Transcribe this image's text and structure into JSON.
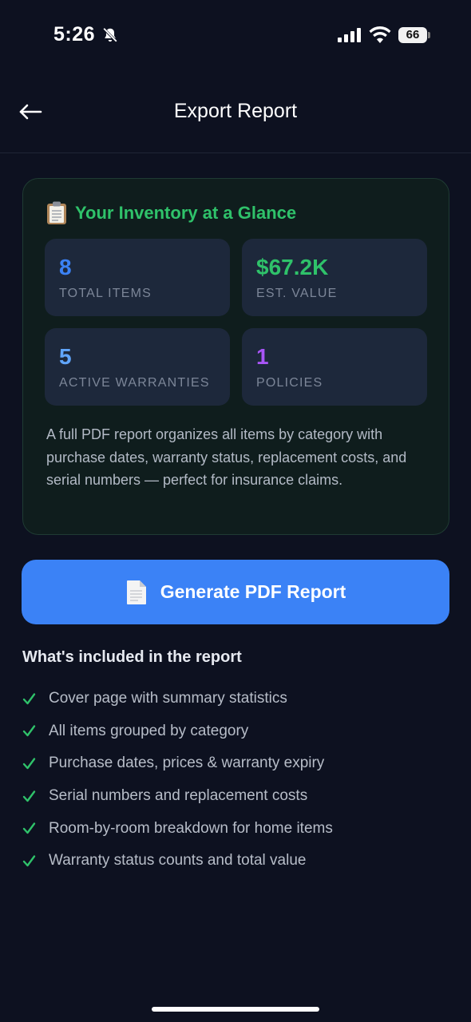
{
  "status": {
    "time": "5:26",
    "battery": "66",
    "icons": [
      "bell-slash-icon",
      "signal-icon",
      "wifi-icon",
      "battery-icon"
    ]
  },
  "header": {
    "title": "Export Report",
    "back_icon": "arrow-left-icon"
  },
  "summary": {
    "emoji_icon": "clipboard-icon",
    "title": "Your Inventory at a Glance",
    "stats": [
      {
        "value": "8",
        "label": "TOTAL ITEMS",
        "color": "#3b82f6"
      },
      {
        "value": "$67.2K",
        "label": "EST. VALUE",
        "color": "#2fc26a"
      },
      {
        "value": "5",
        "label": "ACTIVE WARRANTIES",
        "color": "#60a5fa"
      },
      {
        "value": "1",
        "label": "POLICIES",
        "color": "#a855f7"
      }
    ],
    "description": "A full PDF report organizes all items by category with purchase dates, warranty status, replacement costs, and serial numbers — perfect for insurance claims."
  },
  "generate": {
    "icon": "document-icon",
    "label": "Generate PDF Report",
    "color": "#3b82f6"
  },
  "included": {
    "title": "What's included in the report",
    "check_color": "#2fc26a",
    "items": [
      "Cover page with summary statistics",
      "All items grouped by category",
      "Purchase dates, prices & warranty expiry",
      "Serial numbers and replacement costs",
      "Room-by-room breakdown for home items",
      "Warranty status counts and total value"
    ]
  }
}
